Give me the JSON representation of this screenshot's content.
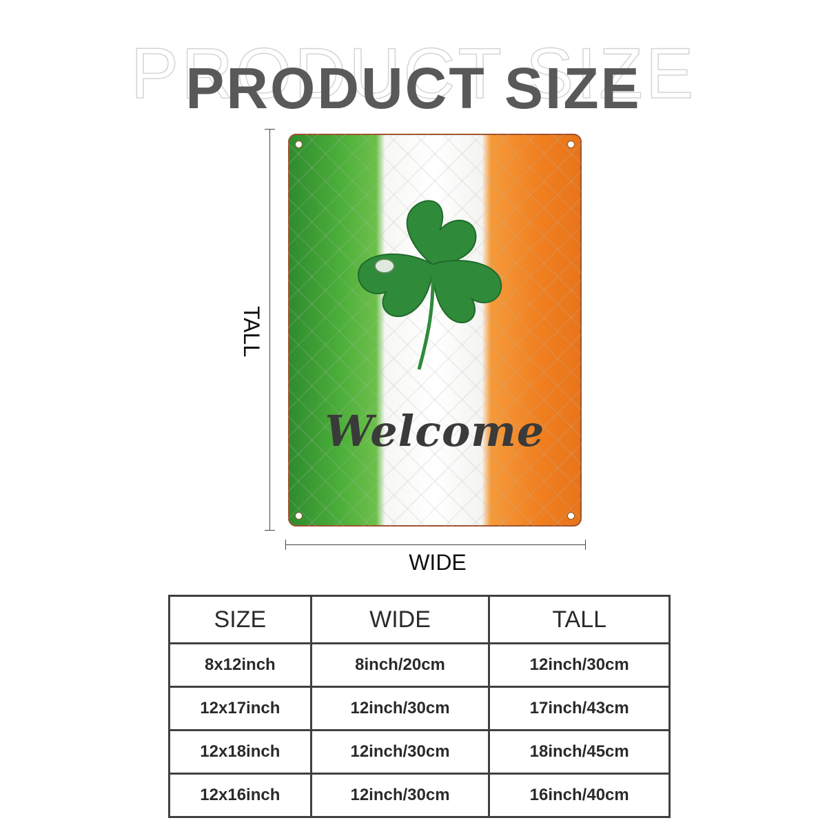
{
  "title": "PRODUCT SIZE",
  "dimension_labels": {
    "tall": "TALL",
    "wide": "WIDE"
  },
  "sign": {
    "text": "Welcome",
    "flag_colors": {
      "green": "#3fa83a",
      "white": "#ffffff",
      "orange": "#f08020"
    },
    "clover_color": "#2f8a3a"
  },
  "table": {
    "headers": [
      "SIZE",
      "WIDE",
      "TALL"
    ],
    "rows": [
      [
        "8x12inch",
        "8inch/20cm",
        "12inch/30cm"
      ],
      [
        "12x17inch",
        "12inch/30cm",
        "17inch/43cm"
      ],
      [
        "12x18inch",
        "12inch/30cm",
        "18inch/45cm"
      ],
      [
        "12x16inch",
        "12inch/30cm",
        "16inch/40cm"
      ]
    ]
  }
}
